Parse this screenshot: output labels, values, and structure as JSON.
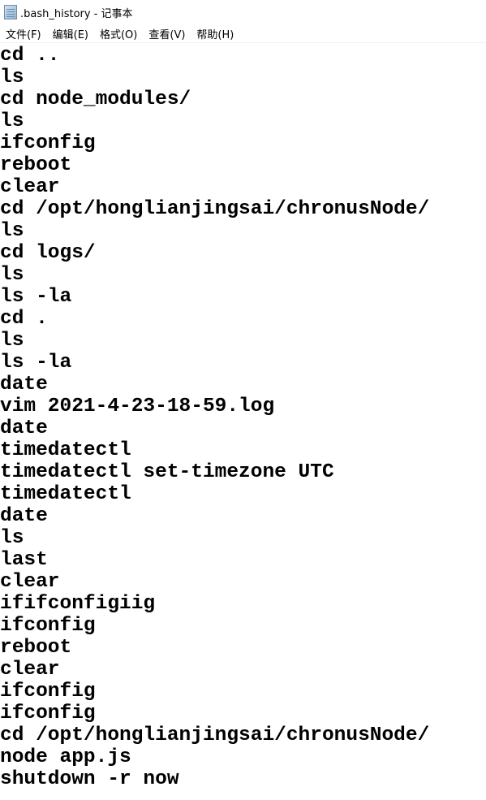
{
  "window": {
    "title": ".bash_history - 记事本",
    "icon": "notepad-icon"
  },
  "menu": [
    "文件(F)",
    "编辑(E)",
    "格式(O)",
    "查看(V)",
    "帮助(H)"
  ],
  "lines": [
    "cd ..",
    "ls",
    "cd node_modules/",
    "ls",
    "ifconfig",
    "reboot",
    "clear",
    "cd /opt/honglianjingsai/chronusNode/",
    "ls",
    "cd logs/",
    "ls",
    "ls -la",
    "cd .",
    "ls",
    "ls -la",
    "date",
    "vim 2021-4-23-18-59.log",
    "date",
    "timedatectl",
    "timedatectl set-timezone UTC",
    "timedatectl",
    "date",
    "ls",
    "last",
    "clear",
    "ififconfigiig",
    "ifconfig",
    "reboot",
    "clear",
    "ifconfig",
    "ifconfig",
    "cd /opt/honglianjingsai/chronusNode/",
    "node app.js",
    "shutdown -r now"
  ]
}
